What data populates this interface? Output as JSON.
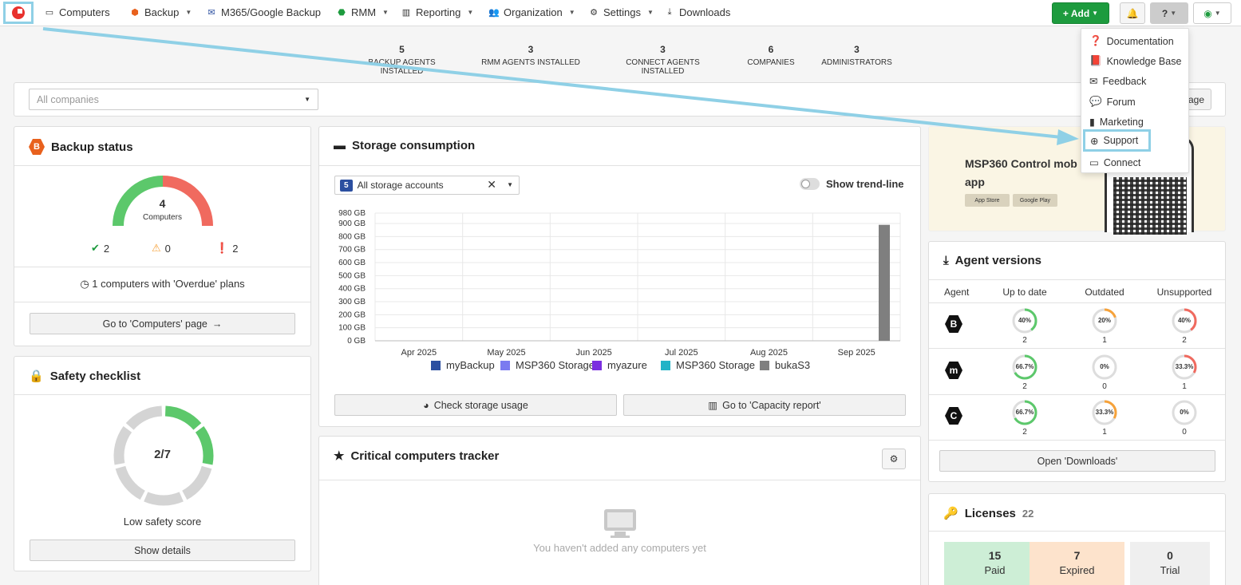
{
  "nav": {
    "computers": "Computers",
    "backup": "Backup",
    "m365": "M365/Google Backup",
    "rmm": "RMM",
    "reporting": "Reporting",
    "organization": "Organization",
    "settings": "Settings",
    "downloads": "Downloads",
    "add": "+ Add"
  },
  "stats": [
    {
      "value": "5",
      "label": "BACKUP AGENTS INSTALLED"
    },
    {
      "value": "3",
      "label": "RMM AGENTS INSTALLED"
    },
    {
      "value": "3",
      "label": "CONNECT AGENTS INSTALLED"
    },
    {
      "value": "6",
      "label": "COMPANIES"
    },
    {
      "value": "3",
      "label": "ADMINISTRATORS"
    }
  ],
  "company_select": {
    "placeholder": "All companies"
  },
  "manage_btn": "age",
  "help_menu": {
    "items": [
      "Documentation",
      "Knowledge Base",
      "Feedback",
      "Forum",
      "Marketing",
      "Support",
      "Connect"
    ]
  },
  "backup_status": {
    "title": "Backup status",
    "total": "4",
    "total_label": "Computers",
    "ok": "2",
    "warn": "0",
    "err": "2",
    "overdue": "1 computers with 'Overdue' plans",
    "goto": "Go to 'Computers' page"
  },
  "safety": {
    "title": "Safety checklist",
    "score": "2/7",
    "score_label": "Low safety score",
    "details": "Show details"
  },
  "storage": {
    "title": "Storage consumption",
    "accounts_count": "5",
    "accounts_label": "All storage accounts",
    "trend": "Show trend-line",
    "check_btn": "Check storage usage",
    "capacity_btn": "Go to 'Capacity report'"
  },
  "chart_data": {
    "type": "bar",
    "title": "",
    "xlabel": "",
    "ylabel": "",
    "categories": [
      "Apr 2025",
      "May 2025",
      "Jun 2025",
      "Jul 2025",
      "Aug 2025",
      "Sep 2025"
    ],
    "y_ticks": [
      "980 GB",
      "900 GB",
      "800 GB",
      "700 GB",
      "600 GB",
      "500 GB",
      "400 GB",
      "300 GB",
      "200 GB",
      "100 GB",
      "0 GB"
    ],
    "ylim": [
      0,
      980
    ],
    "series": [
      {
        "name": "myBackup",
        "color": "#2b4fa0",
        "values": [
          0,
          0,
          0,
          0,
          0,
          0
        ]
      },
      {
        "name": "MSP360 Storage",
        "color": "#7b7bf0",
        "values": [
          0,
          0,
          0,
          0,
          0,
          0
        ]
      },
      {
        "name": "myazure",
        "color": "#7b2fe0",
        "values": [
          0,
          0,
          0,
          0,
          0,
          0
        ]
      },
      {
        "name": "MSP360 Storage",
        "color": "#22b3c7",
        "values": [
          0,
          0,
          0,
          0,
          0,
          0
        ]
      },
      {
        "name": "bukaS3",
        "color": "#7f7f7f",
        "values": [
          0,
          0,
          0,
          0,
          0,
          890
        ]
      }
    ],
    "legend": "bottom",
    "grid": true
  },
  "tracker": {
    "title": "Critical computers tracker",
    "empty": "You haven't added any computers yet"
  },
  "promo": {
    "title": "MSP360 Control mob",
    "title2": "app",
    "appstore": "App Store",
    "googleplay": "Google Play"
  },
  "agent_versions": {
    "title": "Agent versions",
    "headers": [
      "Agent",
      "Up to date",
      "Outdated",
      "Unsupported"
    ],
    "rows": [
      {
        "agent": "backup",
        "cells": [
          {
            "pct": "40%",
            "n": "2",
            "frac": 0.4
          },
          {
            "pct": "20%",
            "n": "1",
            "frac": 0.2
          },
          {
            "pct": "40%",
            "n": "2",
            "frac": 0.4
          }
        ]
      },
      {
        "agent": "rmm",
        "cells": [
          {
            "pct": "66.7%",
            "n": "2",
            "frac": 0.667
          },
          {
            "pct": "0%",
            "n": "0",
            "frac": 0
          },
          {
            "pct": "33.3%",
            "n": "1",
            "frac": 0.333
          }
        ]
      },
      {
        "agent": "connect",
        "cells": [
          {
            "pct": "66.7%",
            "n": "2",
            "frac": 0.667
          },
          {
            "pct": "33.3%",
            "n": "1",
            "frac": 0.333
          },
          {
            "pct": "0%",
            "n": "0",
            "frac": 0
          }
        ]
      }
    ],
    "open_downloads": "Open 'Downloads'"
  },
  "licenses": {
    "title": "Licenses",
    "count": "22",
    "paid": "15",
    "paid_label": "Paid",
    "expired": "7",
    "expired_label": "Expired",
    "trial": "0",
    "trial_label": "Trial"
  },
  "colors": {
    "green": "#5cc86b",
    "red": "#f06a5f",
    "orange": "#f6a23a",
    "grey": "#d4d4d4"
  }
}
